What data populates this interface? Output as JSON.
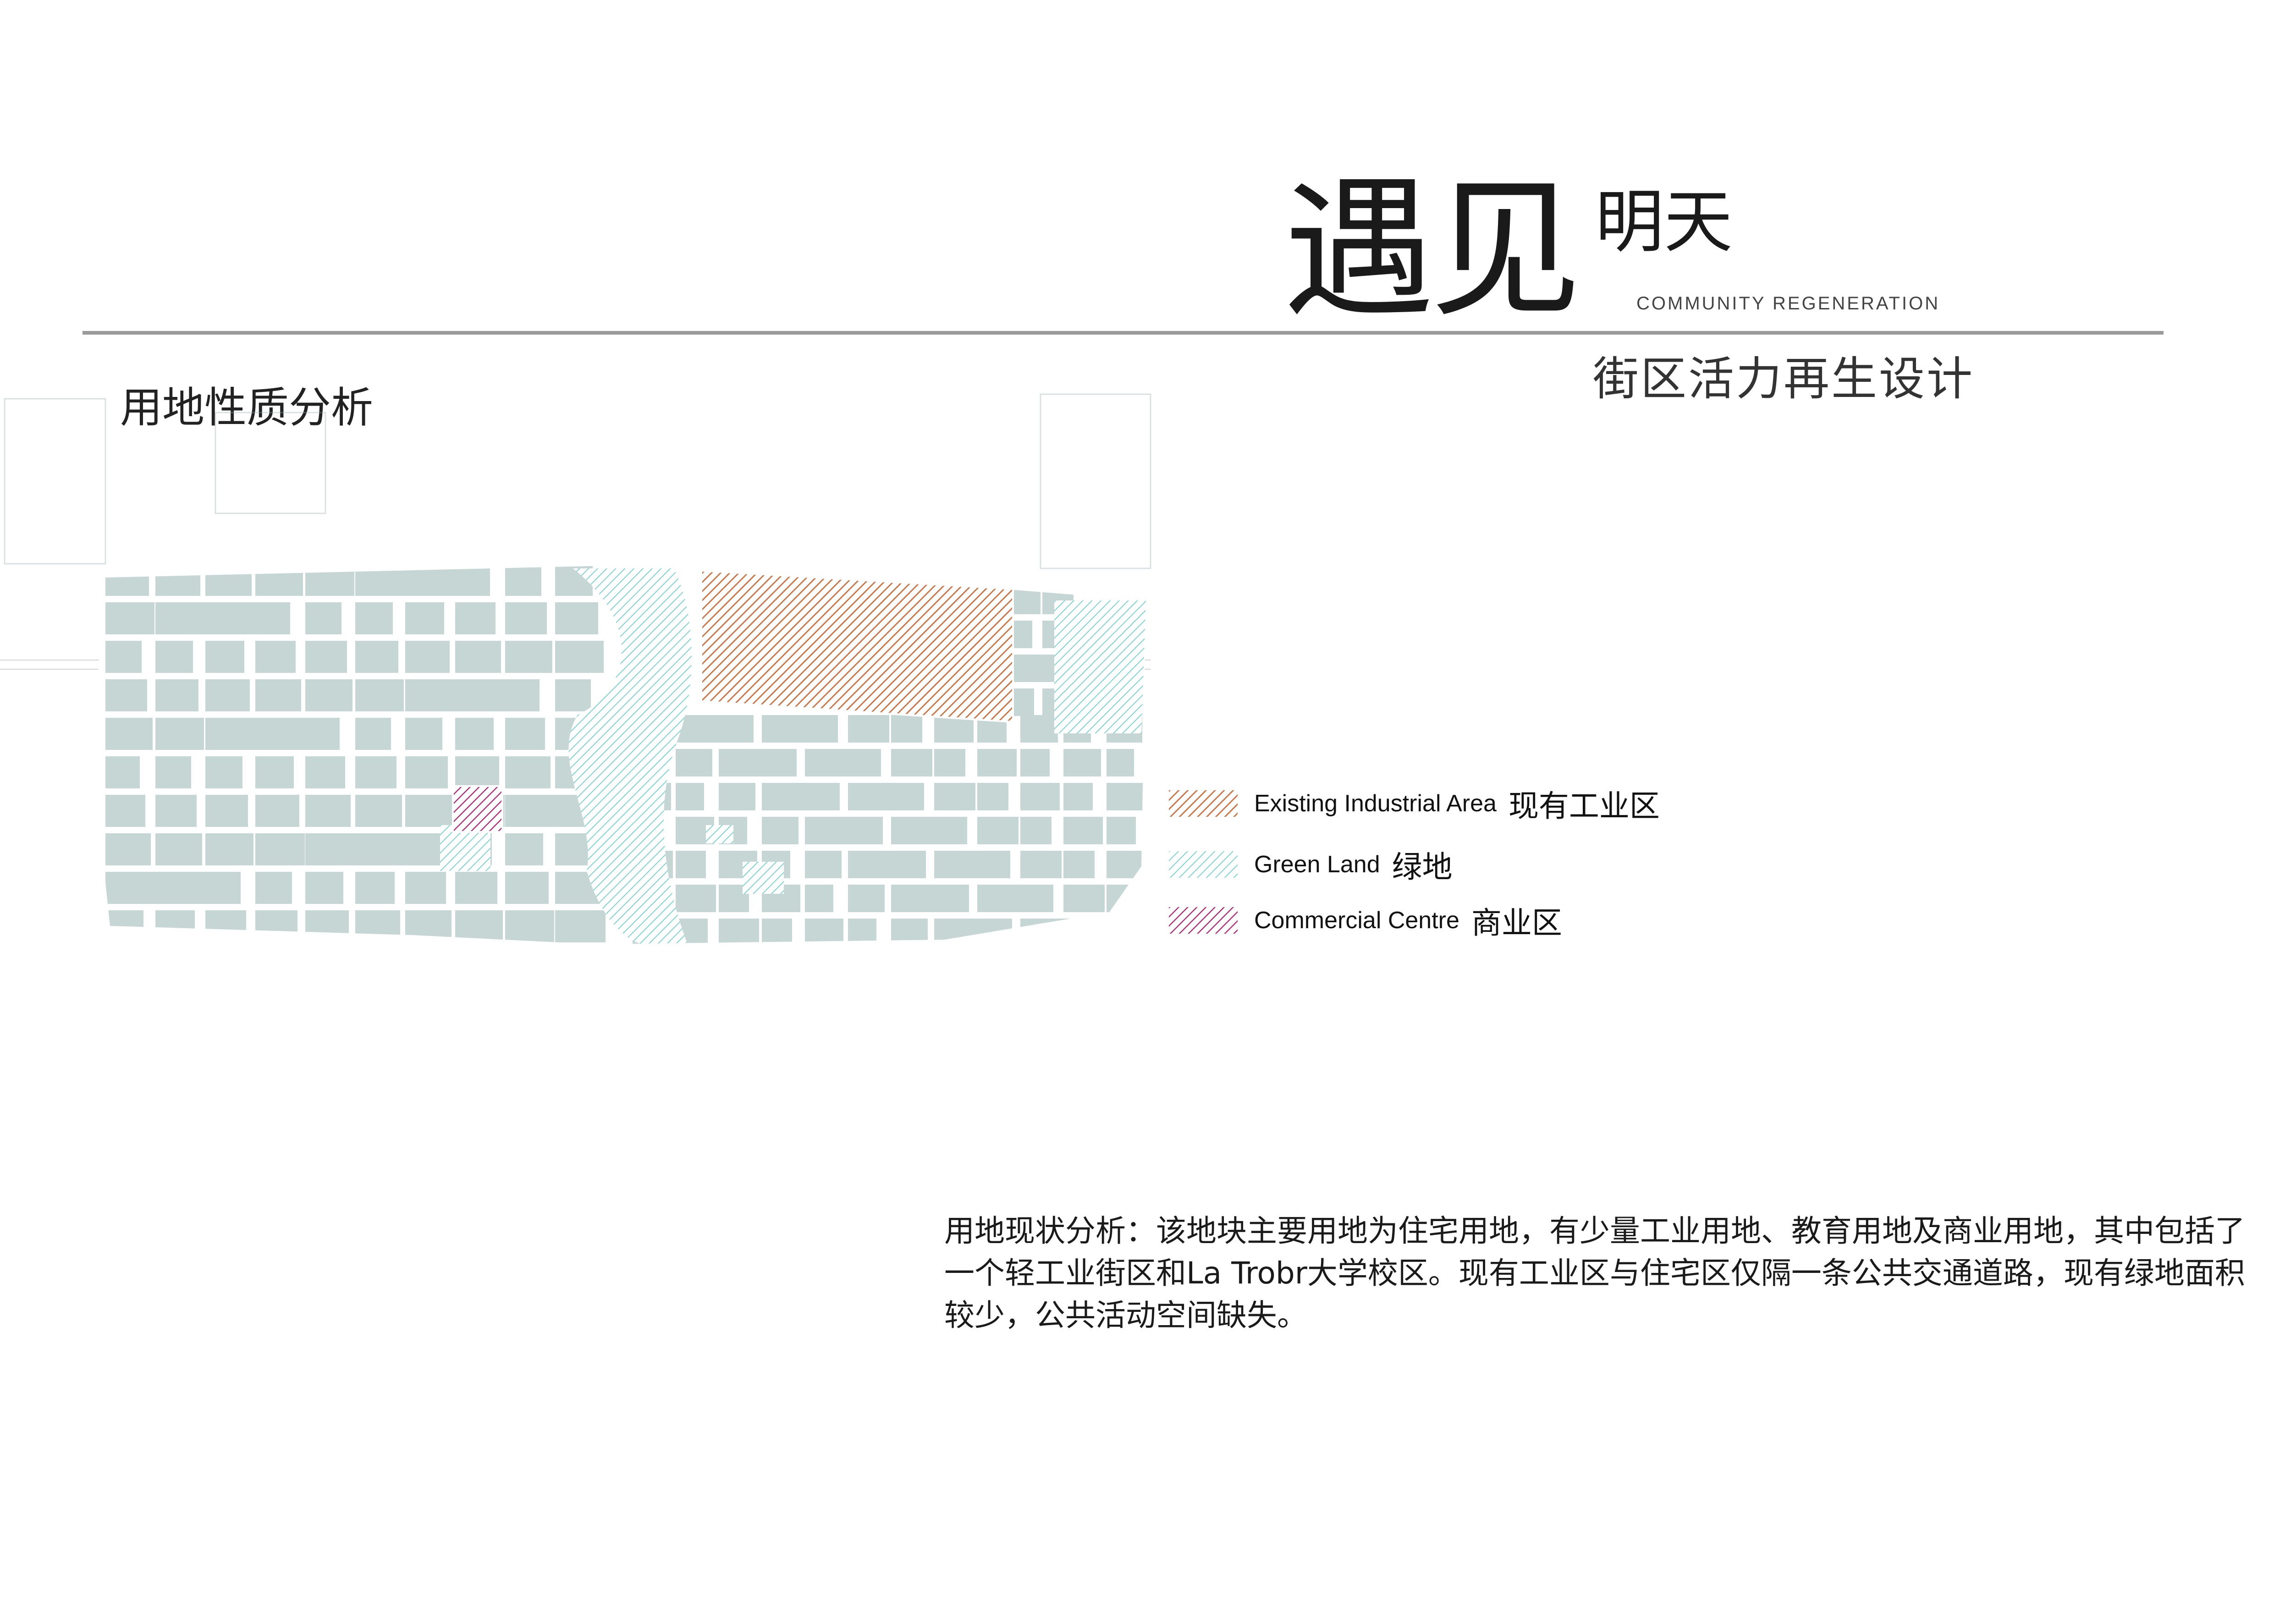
{
  "header": {
    "title_main": "遇见",
    "title_side": "明天",
    "title_en": "COMMUNITY REGENERATION",
    "subtitle": "街区活力再生设计"
  },
  "section": {
    "title": "用地性质分析"
  },
  "legend": {
    "items": [
      {
        "en": "Existing Industrial Area",
        "cn": "现有工业区",
        "color": "#c8784a"
      },
      {
        "en": "Green Land",
        "cn": "绿地",
        "color": "#7ed3d0"
      },
      {
        "en": "Commercial Centre",
        "cn": "商业区",
        "color": "#b0307a"
      }
    ]
  },
  "map_colors": {
    "block": "#c5d6d5",
    "industrial": "#c8784a",
    "green": "#7ed3d0",
    "commercial": "#b0307a"
  },
  "analysis": {
    "text": "用地现状分析：该地块主要用地为住宅用地，有少量工业用地、教育用地及商业用地，其中包括了一个轻工业街区和La Trobr大学校区。现有工业区与住宅区仅隔一条公共交通道路，现有绿地面积较少，公共活动空间缺失。"
  }
}
